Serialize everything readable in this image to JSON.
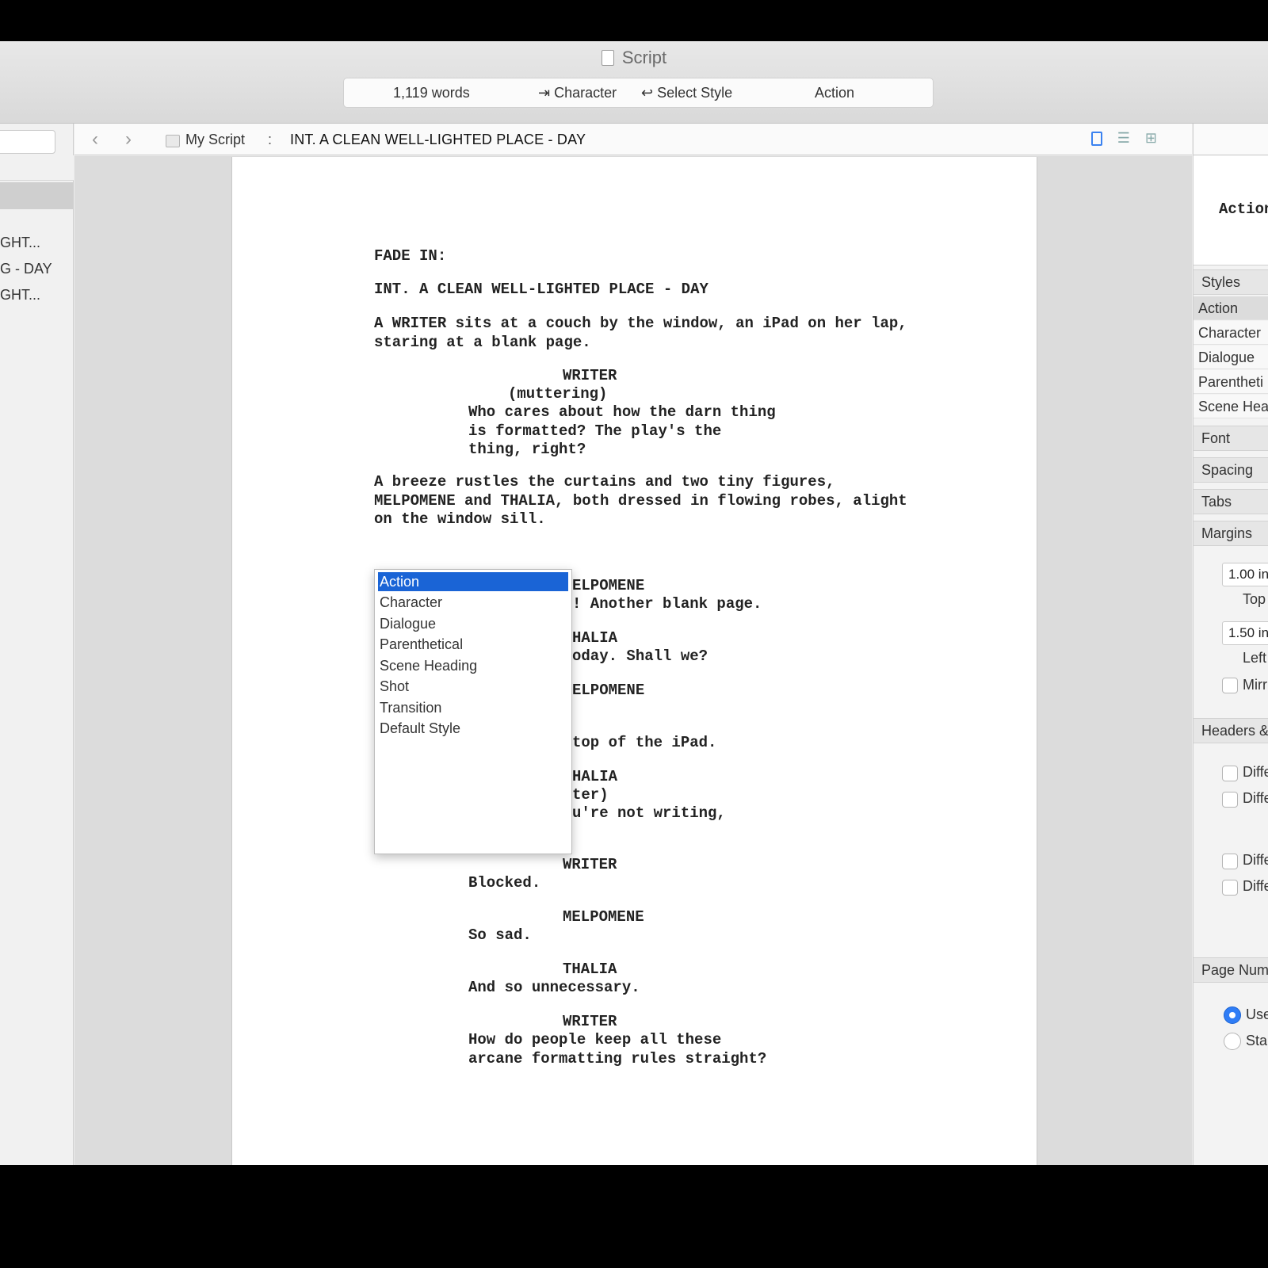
{
  "window": {
    "title": "Script"
  },
  "status_bar": {
    "word_count": "1,119 words",
    "tab_hint": "⇥ Character",
    "return_hint": "↩ Select Style",
    "current_style": "Action"
  },
  "sidebar": {
    "items": [
      "GHT...",
      "G - DAY",
      "GHT..."
    ]
  },
  "nav": {
    "back_glyph": "‹",
    "forward_glyph": "›",
    "breadcrumb_document": "My Script",
    "breadcrumb_separator": ":",
    "breadcrumb_scene": "INT. A CLEAN WELL-LIGHTED PLACE - DAY"
  },
  "script": {
    "fade_in": "FADE IN:",
    "scene_heading": "INT. A CLEAN WELL-LIGHTED PLACE - DAY",
    "action_1": "A WRITER sits at a couch by the window, an iPad on her lap,\nstaring at a blank page.",
    "char_writer_1": "WRITER",
    "paren_1": "(muttering)",
    "dialogue_1": "Who cares about how the darn thing\nis formatted? The play's the\nthing, right?",
    "action_2": "A breeze rustles the curtains and two tiny figures,\nMELPOMENE and THALIA, both dressed in flowing robes, alight\non the window sill.",
    "partial_1": "ELPOMENE",
    "partial_2": "! Another blank page.",
    "partial_3": "HALIA",
    "partial_4": "oday. Shall we?",
    "partial_5": "ELPOMENE",
    "partial_6": "top of the iPad.",
    "partial_7": "HALIA",
    "partial_8": "ter)",
    "partial_9": "u're not writing,",
    "char_writer_2": "WRITER",
    "dialogue_2": "Blocked.",
    "char_melpomene": "MELPOMENE",
    "dialogue_3": "So sad.",
    "char_thalia": "THALIA",
    "dialogue_4": "And so unnecessary.",
    "char_writer_3": "WRITER",
    "dialogue_5": "How do people keep all these\narcane formatting rules straight?"
  },
  "style_popup": {
    "selected": "Action",
    "items": [
      "Action",
      "Character",
      "Dialogue",
      "Parenthetical",
      "Scene Heading",
      "Shot",
      "Transition",
      "Default Style"
    ]
  },
  "inspector": {
    "preview_text": "Action",
    "styles_header": "Styles",
    "styles": [
      "Action",
      "Character",
      "Dialogue",
      "Parentheti",
      "Scene Hea"
    ],
    "font_header": "Font",
    "spacing_header": "Spacing",
    "tabs_header": "Tabs",
    "margins_header": "Margins",
    "margin_top_value": "1.00 in",
    "margin_top_label": "Top",
    "margin_left_value": "1.50 in",
    "margin_left_label": "Left",
    "mirror_label": "Mirr",
    "headers_header": "Headers &",
    "diff_labels": [
      "Diffe",
      "Diffe",
      "Diffe",
      "Diffe"
    ],
    "page_numbers_header": "Page Num",
    "radio_labels": [
      "Use",
      "Sta"
    ]
  },
  "colors": {
    "selection_blue": "#1a64d6",
    "radio_blue": "#2f7df6"
  }
}
